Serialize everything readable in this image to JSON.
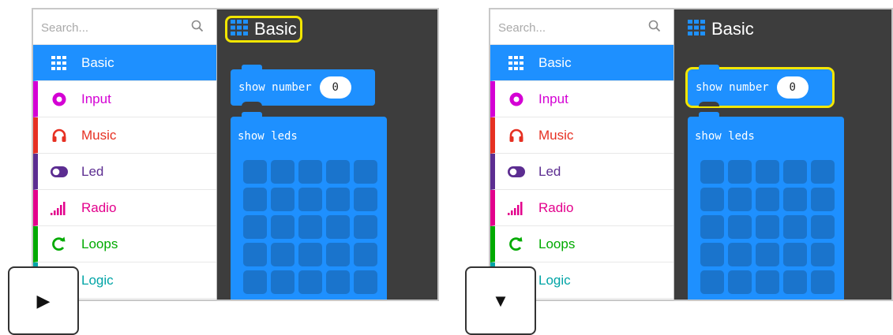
{
  "search": {
    "placeholder": "Search..."
  },
  "categories": [
    {
      "label": "Basic",
      "color": "#1e90ff",
      "icon": "grid-icon"
    },
    {
      "label": "Input",
      "color": "#d400d4",
      "icon": "target-icon"
    },
    {
      "label": "Music",
      "color": "#e63022",
      "icon": "headphones-icon"
    },
    {
      "label": "Led",
      "color": "#5c2d91",
      "icon": "toggle-icon"
    },
    {
      "label": "Radio",
      "color": "#e3008c",
      "icon": "signal-bars-icon"
    },
    {
      "label": "Loops",
      "color": "#00aa00",
      "icon": "loop-arrow-icon"
    },
    {
      "label": "Logic",
      "color": "#00a4a6",
      "icon": "logic-icon"
    }
  ],
  "flyout": {
    "title": "Basic"
  },
  "blocks": {
    "show_number": {
      "label": "show number",
      "value": "0"
    },
    "show_leds": {
      "label": "show leds"
    }
  },
  "panels": [
    {
      "toggle_glyph": "▶",
      "toggle_icon": "play-right-icon"
    },
    {
      "toggle_glyph": "▼",
      "toggle_icon": "expand-down-icon"
    }
  ],
  "colors": {
    "block_blue": "#1e90ff",
    "highlight_yellow": "#f2e600",
    "workspace_bg": "#3d3d3d"
  }
}
